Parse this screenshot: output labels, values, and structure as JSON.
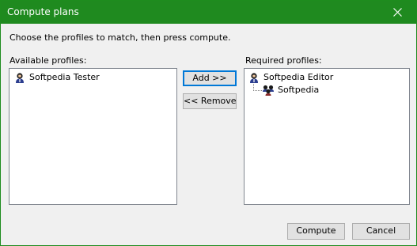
{
  "window": {
    "title": "Compute plans",
    "close_glyph": "close-icon"
  },
  "instruction": "Choose the profiles to match, then press compute.",
  "available": {
    "label": "Available profiles:",
    "items": [
      {
        "label": "Softpedia Tester",
        "icon": "user-profile-icon"
      }
    ]
  },
  "required": {
    "label": "Required profiles:",
    "items": [
      {
        "label": "Softpedia Editor",
        "icon": "user-profile-icon",
        "children": [
          {
            "label": "Softpedia",
            "icon": "user-group-icon"
          }
        ]
      }
    ]
  },
  "buttons": {
    "add": "Add >>",
    "remove": "<< Remove",
    "compute": "Compute",
    "cancel": "Cancel"
  },
  "colors": {
    "titlebar": "#1f8a1f",
    "focus_border": "#0078d7"
  }
}
